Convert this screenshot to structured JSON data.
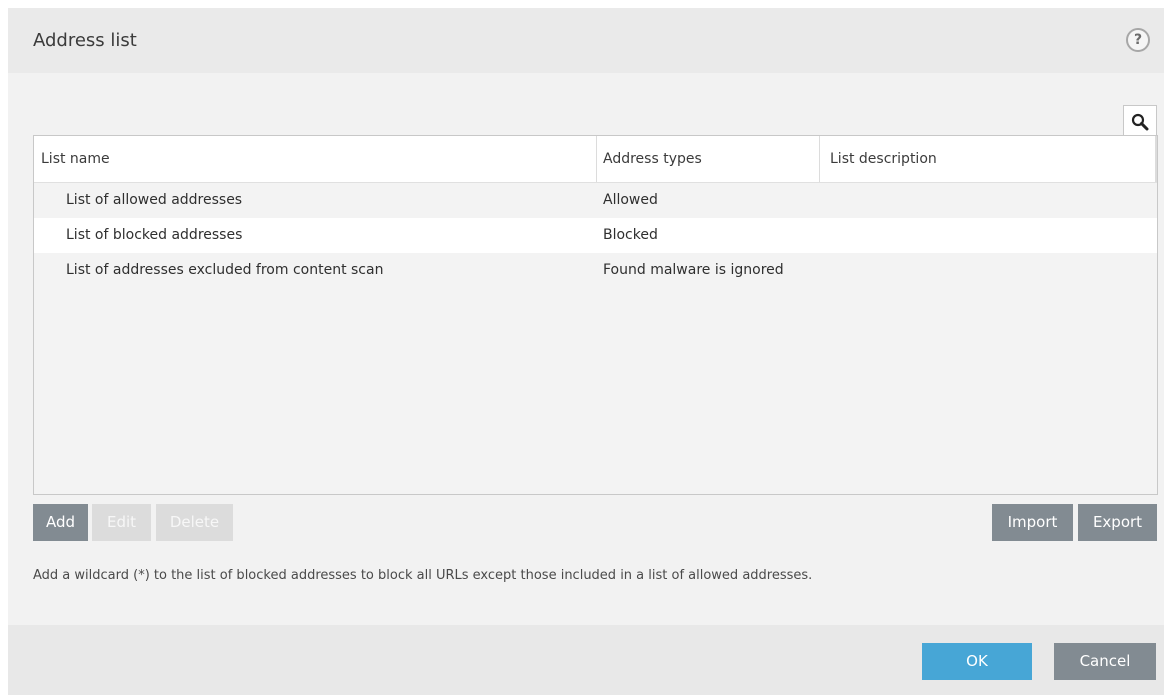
{
  "dialog": {
    "title": "Address list",
    "help_icon": "help-question-icon",
    "help_glyph": "?"
  },
  "search": {
    "icon": "search-icon"
  },
  "table": {
    "columns": [
      "List name",
      "Address types",
      "List description"
    ],
    "rows": [
      {
        "name": "List of allowed addresses",
        "type": "Allowed",
        "description": ""
      },
      {
        "name": "List of blocked addresses",
        "type": "Blocked",
        "description": ""
      },
      {
        "name": "List of addresses excluded from content scan",
        "type": "Found malware is ignored",
        "description": ""
      }
    ]
  },
  "actions": {
    "add": "Add",
    "edit": "Edit",
    "delete": "Delete",
    "import": "Import",
    "export": "Export"
  },
  "hint": "Add a wildcard (*) to the list of blocked addresses to block all URLs except those included in a list of allowed addresses.",
  "footer": {
    "ok": "OK",
    "cancel": "Cancel"
  },
  "colors": {
    "primary": "#47a6d6",
    "button_gray": "#828b92",
    "button_disabled": "#dcdcdc"
  }
}
